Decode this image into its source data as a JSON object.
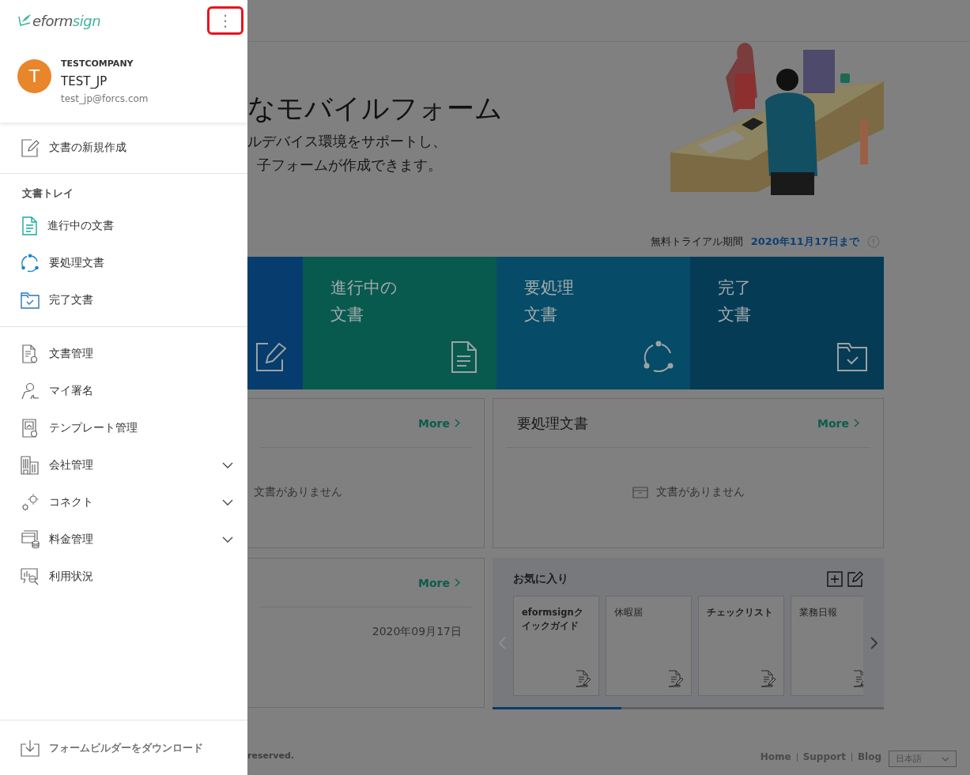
{
  "sidebar": {
    "brand": [
      "eform",
      "sign"
    ],
    "menu_button": {
      "label": "⋮",
      "highlighted": true
    },
    "profile": {
      "avatar": "T",
      "company": "TESTCOMPANY",
      "name": "TEST_JP",
      "email": "test_jp@forcs.com"
    },
    "new_document": "文書の新規作成",
    "tray": {
      "title": "文書トレイ",
      "items": [
        {
          "label": "進行中の文書"
        },
        {
          "label": "要処理文書"
        },
        {
          "label": "完了文書"
        }
      ]
    },
    "items": [
      {
        "label": "文書管理"
      },
      {
        "label": "マイ署名"
      },
      {
        "label": "テンプレート管理"
      },
      {
        "label": "会社管理",
        "expanded": false
      },
      {
        "label": "コネクト",
        "expanded": false
      },
      {
        "label": "料金管理",
        "expanded": false
      },
      {
        "label": "利用状況"
      }
    ],
    "download": "フォームビルダーをダウンロード"
  },
  "hero": {
    "title": "なモバイルフォーム",
    "lines": [
      "ルデバイス環境をサポートし、",
      "子フォームが作成できます。"
    ]
  },
  "trial": {
    "label": "無料トライアル期間",
    "date": "2020年11月17日まで"
  },
  "tiles": [
    {
      "kind": "create"
    },
    {
      "kind": "progress",
      "lines": [
        "進行中の",
        "文書"
      ]
    },
    {
      "kind": "action",
      "lines": [
        "要処理",
        "文書"
      ]
    },
    {
      "kind": "done",
      "lines": [
        "完了",
        "文書"
      ]
    }
  ],
  "cards": [
    {
      "more": "More",
      "empty": "文書がありません"
    },
    {
      "title": "要処理文書",
      "more": "More",
      "empty": "文書がありません"
    },
    {
      "more": "More",
      "date": "2020年09月17日"
    }
  ],
  "favorites": {
    "title": "お気に入り",
    "items": [
      {
        "label": "eformsignクイックガイド"
      },
      {
        "label": "休暇届"
      },
      {
        "label": "チェックリスト"
      },
      {
        "label": "業務日報"
      }
    ],
    "level": 0.33
  },
  "footer": {
    "copyright": "reserved.",
    "links": [
      "Home",
      "Support",
      "Blog"
    ],
    "language": "日本語"
  }
}
